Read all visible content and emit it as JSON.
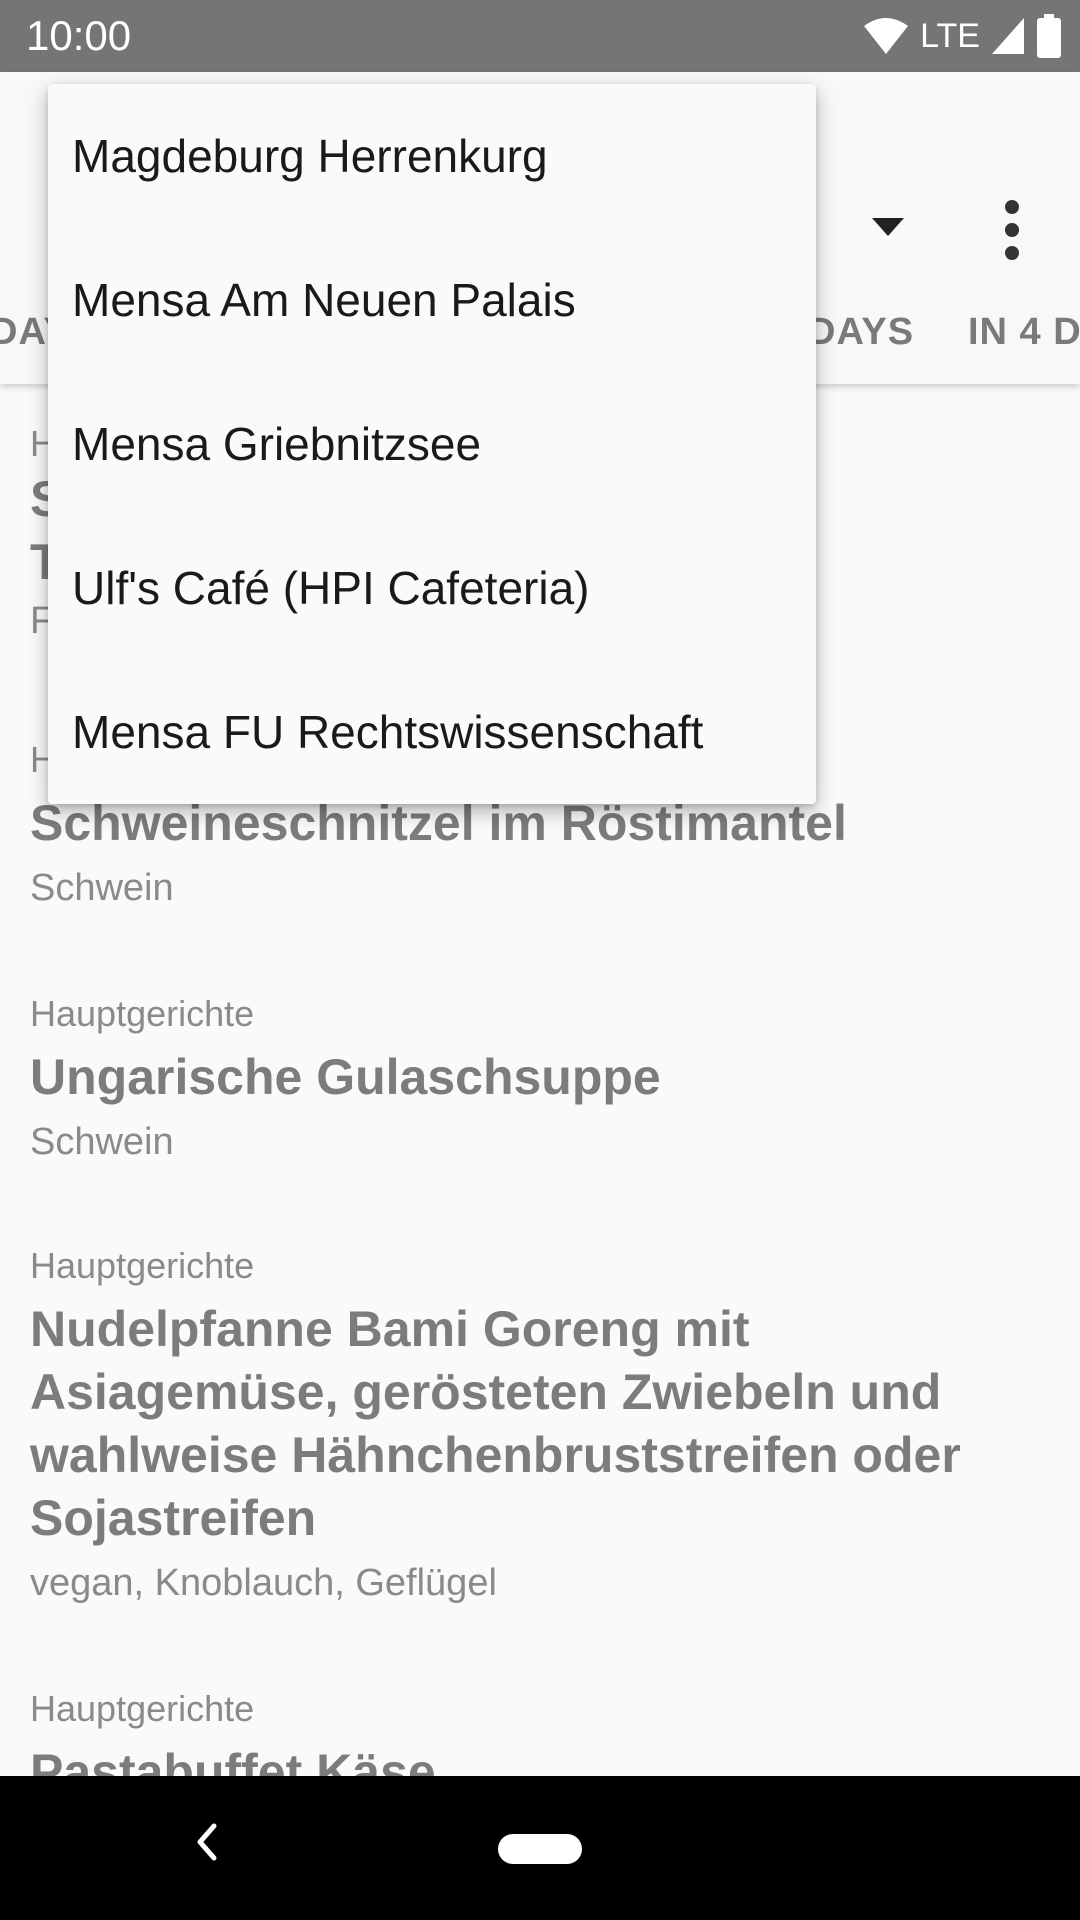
{
  "status_bar": {
    "time": "10:00",
    "network": "LTE"
  },
  "tabs": [
    "DAY",
    "DAYS",
    "IN 4 D"
  ],
  "menu_items": [
    "Magdeburg Herrenkurg",
    "Mensa Am Neuen Palais",
    "Mensa Griebnitzsee",
    "Ulf's Café (HPI Cafeteria)",
    "Mensa FU Rechtswissenschaft"
  ],
  "meals": [
    {
      "category": "H",
      "title_line1": "S",
      "title_line2": "T",
      "tags": "F"
    },
    {
      "category": "H",
      "title": "Schweineschnitzel im Röstimantel",
      "tags": "Schwein"
    },
    {
      "category": "Hauptgerichte",
      "title": "Ungarische Gulaschsuppe",
      "tags": "Schwein"
    },
    {
      "category": "Hauptgerichte",
      "title": "Nudelpfanne Bami Goreng mit Asiagemüse, gerösteten Zwiebeln und wahlweise Hähnchenbruststreifen oder Sojastreifen",
      "tags": "vegan, Knoblauch, Geflügel"
    },
    {
      "category": "Hauptgerichte",
      "title": "Pastabuffet Käse"
    }
  ],
  "icons": {
    "wifi": "wifi-icon",
    "signal": "signal-icon",
    "battery": "battery-icon",
    "dropdown": "dropdown-arrow-icon",
    "overflow": "overflow-menu-icon",
    "back": "back-icon",
    "home": "home-pill-icon"
  }
}
